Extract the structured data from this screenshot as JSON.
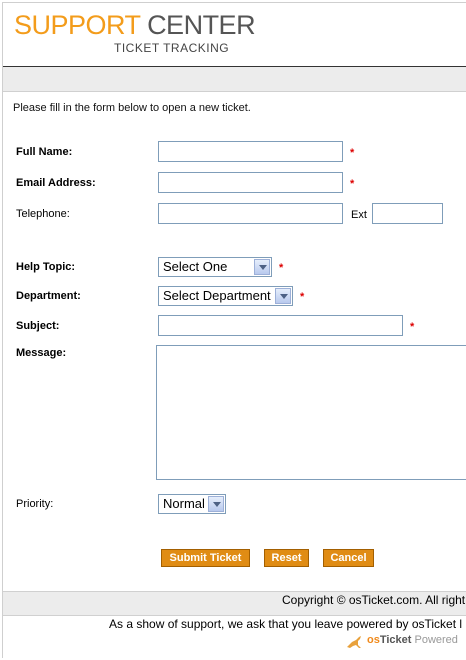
{
  "header": {
    "title_part1": "SUPPORT",
    "title_part2": "CENTER",
    "subtitle": "TICKET TRACKING"
  },
  "form": {
    "intro": "Please fill in the form below to open a new ticket.",
    "full_name": {
      "label": "Full Name:",
      "value": "",
      "required": "*"
    },
    "email": {
      "label": "Email Address:",
      "value": "",
      "required": "*"
    },
    "telephone": {
      "label": "Telephone:",
      "value": "",
      "ext_label": "Ext",
      "ext_value": ""
    },
    "help_topic": {
      "label": "Help Topic:",
      "selected": "Select One",
      "required": "*"
    },
    "department": {
      "label": "Department:",
      "selected": "Select Department",
      "required": "*"
    },
    "subject": {
      "label": "Subject:",
      "value": "",
      "required": "*"
    },
    "message": {
      "label": "Message:",
      "value": ""
    },
    "priority": {
      "label": "Priority:",
      "selected": "Normal"
    },
    "buttons": {
      "submit": "Submit Ticket",
      "reset": "Reset",
      "cancel": "Cancel"
    }
  },
  "footer": {
    "copyright": "Copyright © osTicket.com. All right",
    "support_note": "As a show of support, we ask that you leave powered by osTicket l",
    "powered_os": "os",
    "powered_ticket": "Ticket",
    "powered_text": "Powered"
  },
  "colors": {
    "brand_orange": "#f39c1b",
    "button_orange": "#e08c14",
    "required_red": "#dd0000"
  }
}
